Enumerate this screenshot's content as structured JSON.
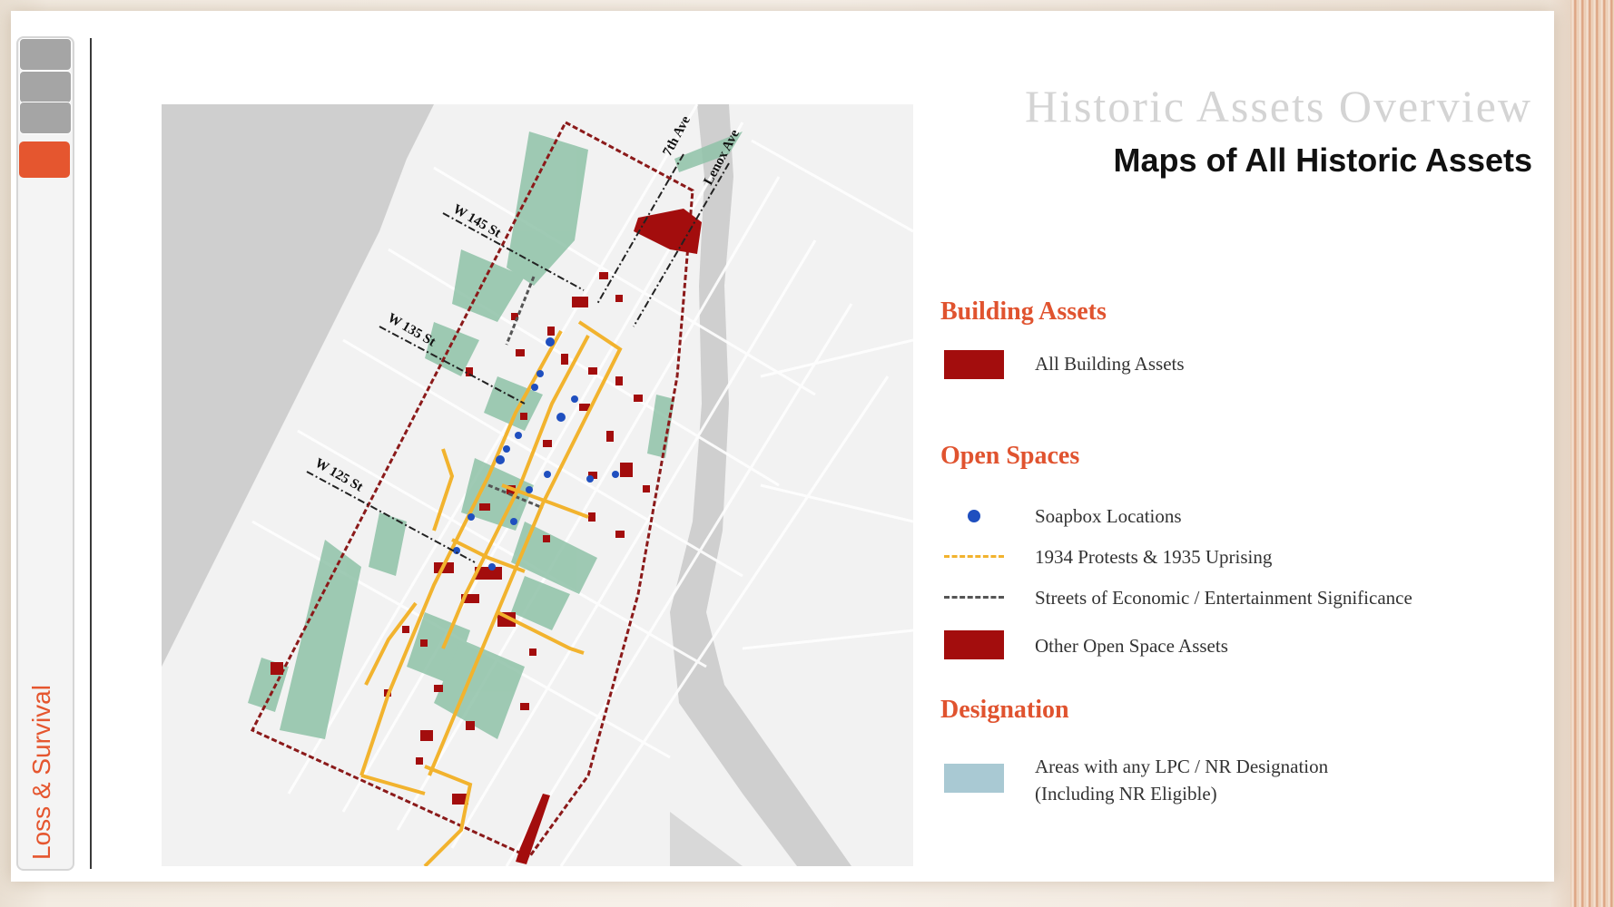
{
  "sidebar": {
    "section_label": "Loss & Survival",
    "tabs": [
      {
        "state": "inactive"
      },
      {
        "state": "inactive"
      },
      {
        "state": "inactive"
      },
      {
        "state": "active"
      }
    ]
  },
  "header": {
    "title": "Historic Assets Overview",
    "subtitle": "Maps of All Historic Assets"
  },
  "map": {
    "street_labels": [
      "W 145 St",
      "W 135 St",
      "W 125 St",
      "7th Ave",
      "Lenox Ave"
    ]
  },
  "legend": {
    "building_assets": {
      "heading": "Building Assets",
      "items": [
        {
          "label": "All Building Assets",
          "color": "#a30d0d"
        }
      ]
    },
    "open_spaces": {
      "heading": "Open Spaces",
      "items": [
        {
          "label": "Soapbox Locations",
          "color": "#1f4fbf",
          "symbol": "dot"
        },
        {
          "label": "1934 Protests & 1935 Uprising",
          "color": "#f2b32e",
          "symbol": "dashed-line"
        },
        {
          "label": "Streets of Economic / Entertainment Significance",
          "color": "#555555",
          "symbol": "dashed-line"
        },
        {
          "label": "Other Open Space Assets",
          "color": "#a30d0d",
          "symbol": "rect"
        }
      ]
    },
    "designation": {
      "heading": "Designation",
      "items": [
        {
          "label_line1": "Areas with any LPC / NR Designation",
          "label_line2": "(Including NR Eligible)",
          "color": "#a9c9d3",
          "symbol": "rect"
        }
      ]
    }
  },
  "colors": {
    "accent": "#e5562f",
    "building": "#a30d0d",
    "designation_green": "#8fc2a8",
    "protest_path": "#f2b32e",
    "boundary": "#8b1a1a"
  }
}
